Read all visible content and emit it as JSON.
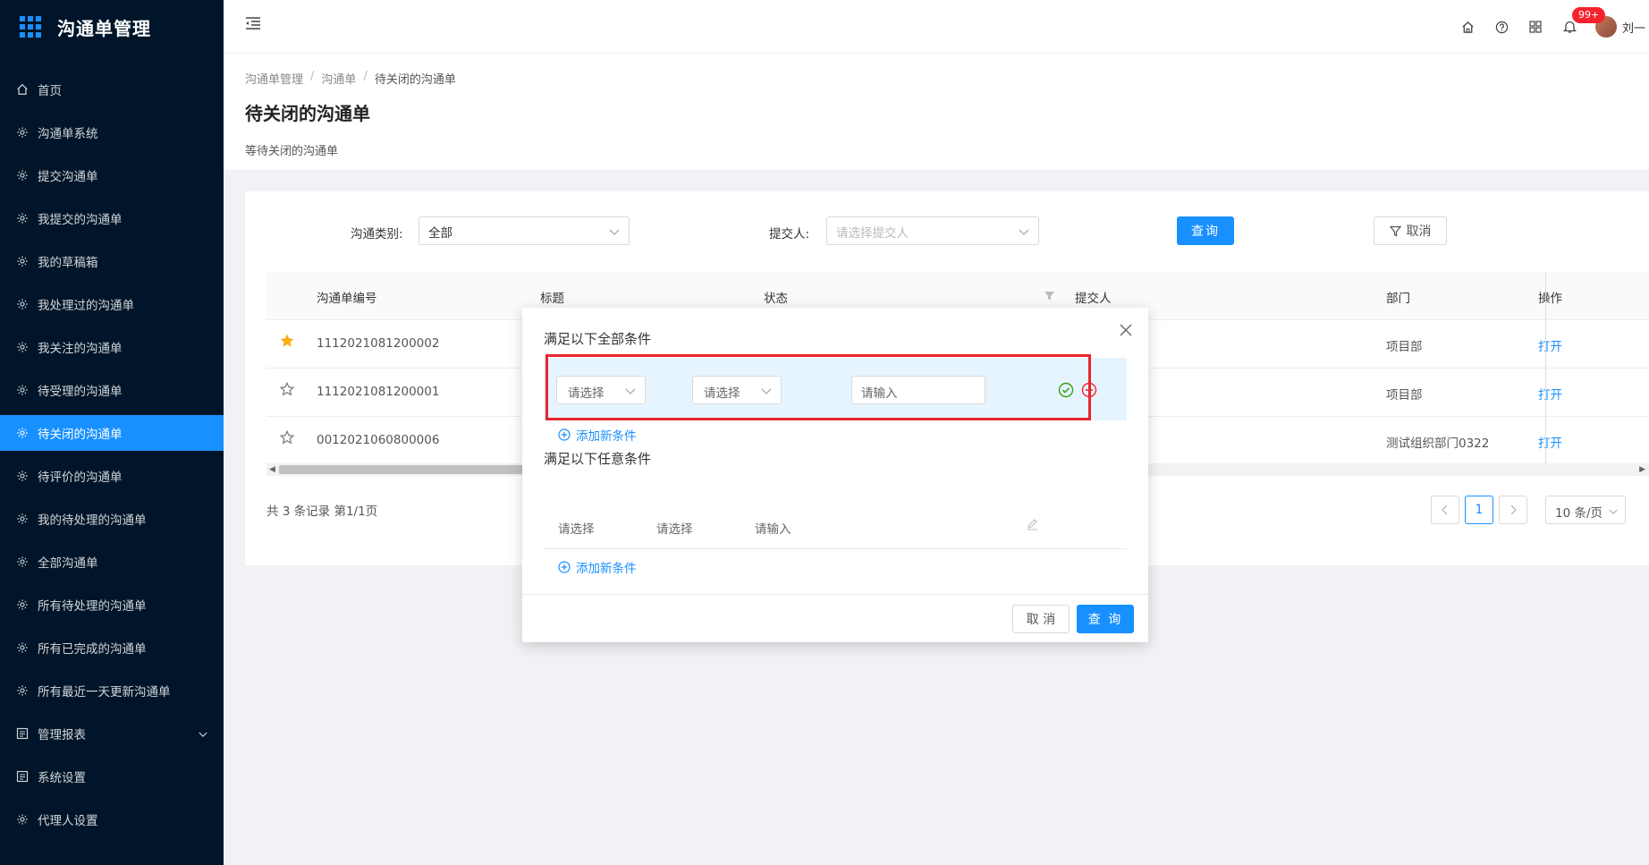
{
  "app": {
    "title": "沟通单管理"
  },
  "sidebar": {
    "items": [
      {
        "label": "首页",
        "icon": "home-icon"
      },
      {
        "label": "沟通单系统",
        "icon": "gear-icon"
      },
      {
        "label": "提交沟通单",
        "icon": "gear-icon"
      },
      {
        "label": "我提交的沟通单",
        "icon": "gear-icon"
      },
      {
        "label": "我的草稿箱",
        "icon": "gear-icon"
      },
      {
        "label": "我处理过的沟通单",
        "icon": "gear-icon"
      },
      {
        "label": "我关注的沟通单",
        "icon": "gear-icon"
      },
      {
        "label": "待受理的沟通单",
        "icon": "gear-icon"
      },
      {
        "label": "待关闭的沟通单",
        "icon": "gear-icon",
        "active": true
      },
      {
        "label": "待评价的沟通单",
        "icon": "gear-icon"
      },
      {
        "label": "我的待处理的沟通单",
        "icon": "gear-icon"
      },
      {
        "label": "全部沟通单",
        "icon": "gear-icon"
      },
      {
        "label": "所有待处理的沟通单",
        "icon": "gear-icon"
      },
      {
        "label": "所有已完成的沟通单",
        "icon": "gear-icon"
      },
      {
        "label": "所有最近一天更新沟通单",
        "icon": "gear-icon"
      },
      {
        "label": "管理报表",
        "icon": "report-icon",
        "expandable": true
      },
      {
        "label": "系统设置",
        "icon": "report-icon"
      },
      {
        "label": "代理人设置",
        "icon": "gear-icon"
      }
    ]
  },
  "header": {
    "notification_badge": "99+",
    "username": "刘一"
  },
  "page": {
    "breadcrumb": [
      "沟通单管理",
      "沟通单",
      "待关闭的沟通单"
    ],
    "title": "待关闭的沟通单",
    "description": "等待关闭的沟通单"
  },
  "filter": {
    "category_label": "沟通类别:",
    "category_value": "全部",
    "submitter_label": "提交人:",
    "submitter_placeholder": "请选择提交人",
    "query_label": "查询",
    "cancel_label": "取消"
  },
  "table": {
    "columns": [
      "沟通单编号",
      "标题",
      "状态",
      "提交人",
      "部门",
      "操作"
    ],
    "rows": [
      {
        "starred": true,
        "id": "1112021081200002",
        "dept": "项目部",
        "action": "打开"
      },
      {
        "starred": false,
        "id": "1112021081200001",
        "dept": "项目部",
        "action": "打开"
      },
      {
        "starred": false,
        "id": "0012021060800006",
        "dept": "测试组织部门0322",
        "action": "打开"
      }
    ]
  },
  "pagination": {
    "total_text": "共 3 条记录 第1/1页",
    "current_page": "1",
    "page_size": "10 条/页"
  },
  "modal": {
    "all_title": "满足以下全部条件",
    "any_title": "满足以下任意条件",
    "select_placeholder": "请选择",
    "input_placeholder": "请输入",
    "add_condition": "添加新条件",
    "cancel_label": "取 消",
    "query_label": "查 询"
  },
  "colors": {
    "primary": "#1890ff",
    "sidebar_bg": "#001529",
    "highlight": "#e8262d",
    "success": "#389e0d",
    "danger": "#f5222d",
    "star": "#faad14"
  }
}
